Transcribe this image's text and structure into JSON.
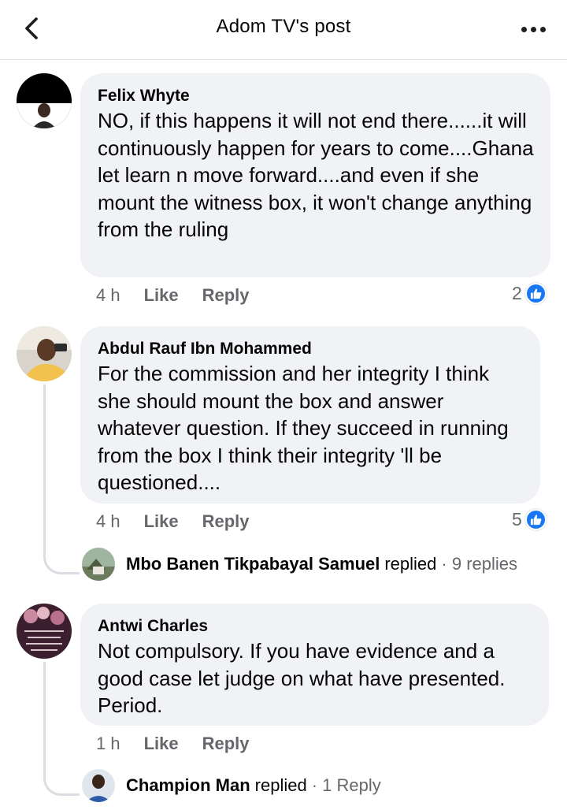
{
  "header": {
    "title": "Adom TV's post",
    "back_icon": "chevron-left-icon",
    "more_icon": "more-horizontal-icon"
  },
  "colors": {
    "accent": "#1877f2",
    "bubble": "#f0f2f5",
    "muted_text": "#65676b"
  },
  "comments": [
    {
      "author": "Felix Whyte",
      "text": "NO, if this happens it will not end there......it will continuously happen for years to come....Ghana let learn n move forward....and even if she mount the witness box, it won't change anything from the ruling",
      "time": "4 h",
      "like_label": "Like",
      "reply_label": "Reply",
      "reactions": "2"
    },
    {
      "author": "Abdul Rauf Ibn Mohammed",
      "text": "For the commission and her integrity I think she should mount the box and answer whatever question. If they succeed in running from the box  I think their integrity 'll be questioned....",
      "time": "4 h",
      "like_label": "Like",
      "reply_label": "Reply",
      "reactions": "5",
      "replies_summary": {
        "name": "Mbo Banen Tikpabayal Samuel",
        "verb": "replied",
        "count": "· 9 replies"
      }
    },
    {
      "author": "Antwi Charles",
      "text": "Not compulsory.  If you have evidence and a good case let judge on what have presented.  Period.",
      "time": "1 h",
      "like_label": "Like",
      "reply_label": "Reply",
      "replies_summary": {
        "name": "Champion Man",
        "verb": "replied",
        "count": "· 1 Reply"
      }
    }
  ]
}
